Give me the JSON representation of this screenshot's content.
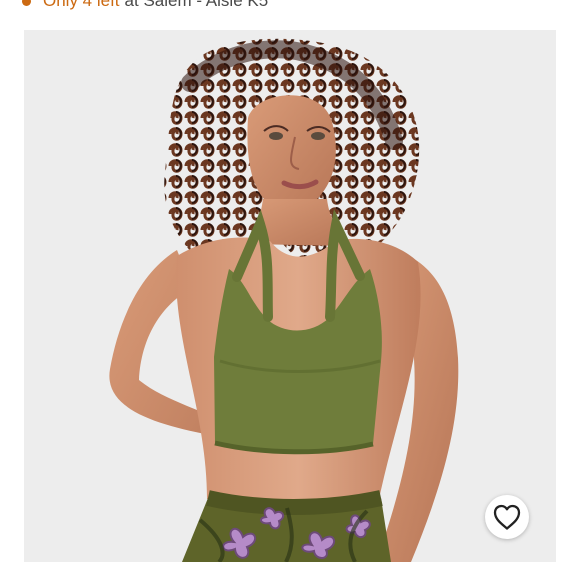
{
  "stock": {
    "status": "Only 4 left",
    "location": "at Salem - Aisle K5",
    "status_color": "#cc6a12"
  },
  "product_image": {
    "alt": "Model wearing olive green halter bra top with floral shorts",
    "background_color": "#ededed",
    "top_color": "#6f7d3b",
    "shorts_color": "#5e6429",
    "floral_color": "#b58bc8"
  },
  "favorite": {
    "icon": "heart-icon",
    "label": "Add to favorites"
  }
}
